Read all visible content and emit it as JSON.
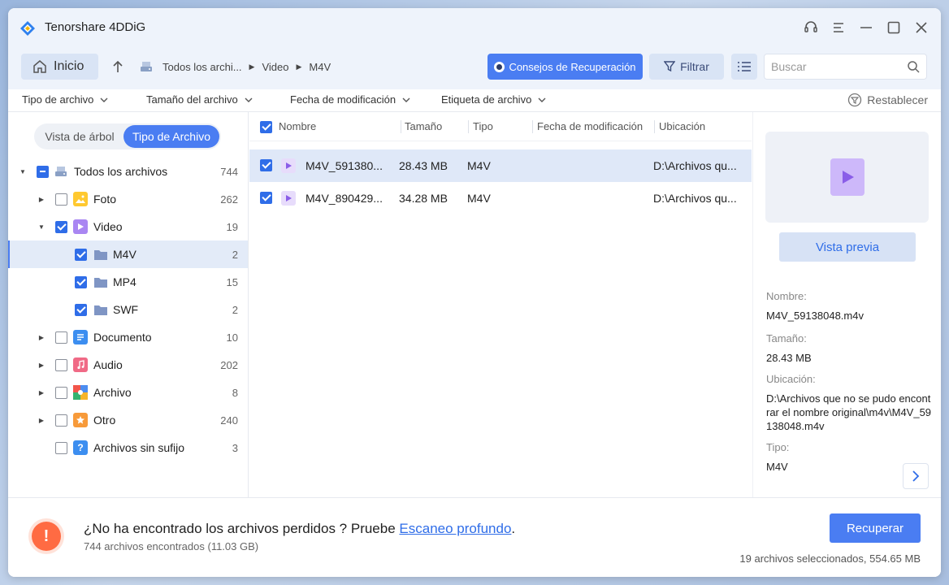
{
  "app": {
    "title": "Tenorshare 4DDiG"
  },
  "toolbar": {
    "home_label": "Inicio",
    "breadcrumb": [
      "Todos los archi...",
      "Video",
      "M4V"
    ],
    "tips_label": "Consejos de Recuperación",
    "filter_label": "Filtrar",
    "search_placeholder": "Buscar"
  },
  "filters": {
    "items": [
      "Tipo de archivo",
      "Tamaño del archivo",
      "Fecha de modificación",
      "Etiqueta de archivo"
    ],
    "reset_label": "Restablecer"
  },
  "sidebar": {
    "view_tree": "Vista de árbol",
    "view_type": "Tipo de Archivo",
    "tree": [
      {
        "label": "Todos los archivos",
        "count": "744"
      },
      {
        "label": "Foto",
        "count": "262"
      },
      {
        "label": "Video",
        "count": "19"
      },
      {
        "label": "M4V",
        "count": "2"
      },
      {
        "label": "MP4",
        "count": "15"
      },
      {
        "label": "SWF",
        "count": "2"
      },
      {
        "label": "Documento",
        "count": "10"
      },
      {
        "label": "Audio",
        "count": "202"
      },
      {
        "label": "Archivo",
        "count": "8"
      },
      {
        "label": "Otro",
        "count": "240"
      },
      {
        "label": "Archivos sin sufijo",
        "count": "3"
      }
    ]
  },
  "list": {
    "columns": [
      "Nombre",
      "Tamaño",
      "Tipo",
      "Fecha de modificación",
      "Ubicación"
    ],
    "rows": [
      {
        "name": "M4V_591380...",
        "size": "28.43 MB",
        "type": "M4V",
        "date": "",
        "location": "D:\\Archivos qu..."
      },
      {
        "name": "M4V_890429...",
        "size": "34.28 MB",
        "type": "M4V",
        "date": "",
        "location": "D:\\Archivos qu..."
      }
    ]
  },
  "details": {
    "preview_label": "Vista previa",
    "name_label": "Nombre:",
    "name_value": "M4V_59138048.m4v",
    "size_label": "Tamaño:",
    "size_value": "28.43 MB",
    "location_label": "Ubicación:",
    "location_value": "D:\\Archivos que no se pudo encontrar el nombre original\\m4v\\M4V_59138048.m4v",
    "type_label": "Tipo:",
    "type_value": "M4V"
  },
  "footer": {
    "message_prefix": "¿No ha encontrado los archivos perdidos ? Pruebe ",
    "deep_scan_link": "Escaneo profundo",
    "message_suffix": ".",
    "found_text": "744 archivos encontrados (11.03 GB)",
    "recover_label": "Recuperar",
    "selected_text": "19 archivos seleccionados, 554.65 MB"
  },
  "colors": {
    "accent": "#4a7df2",
    "warning": "#ff6b43",
    "selected_row": "#dfe8f8"
  }
}
